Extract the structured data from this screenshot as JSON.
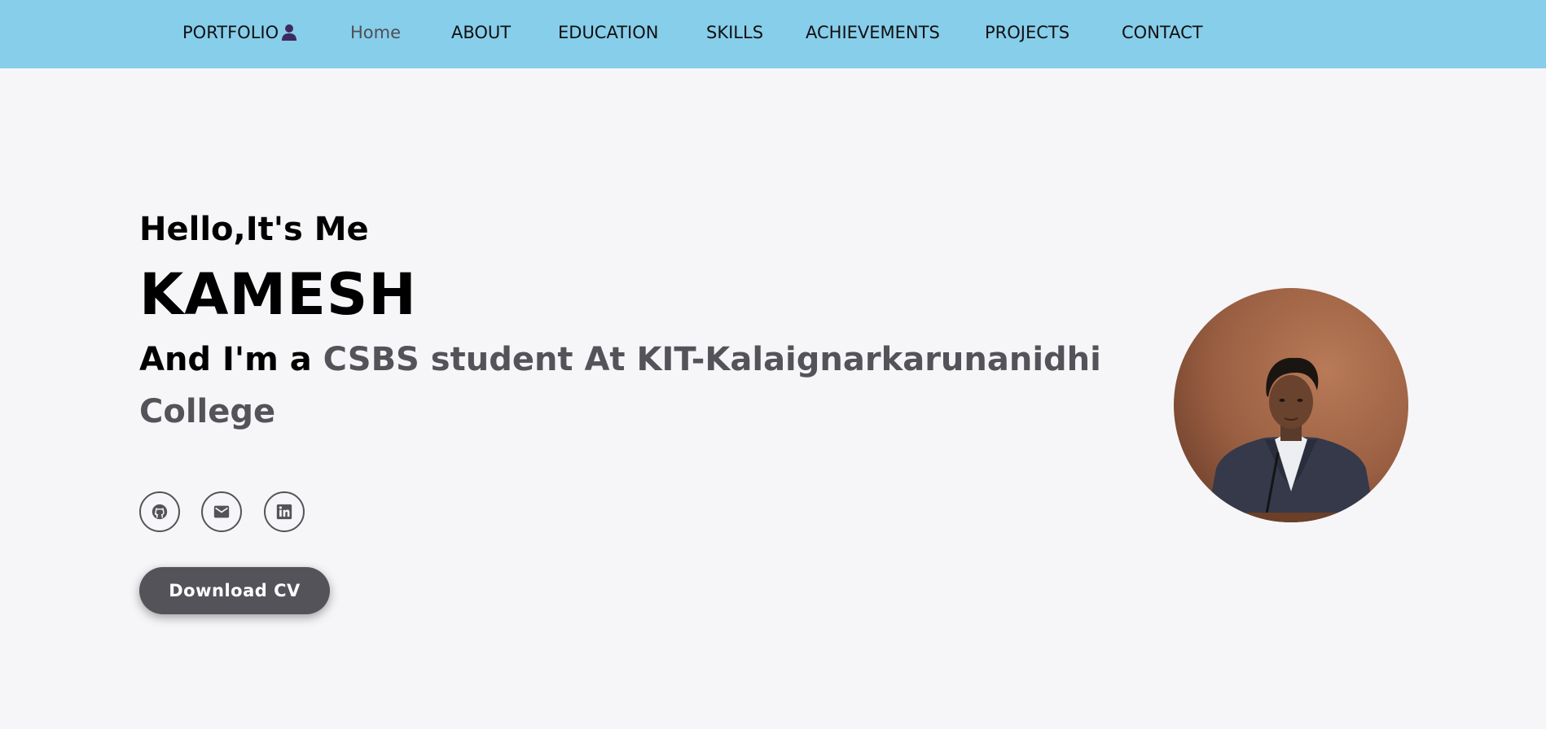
{
  "nav": {
    "brand_label": "PORTFOLIO",
    "brand_icon": "person-icon",
    "items": [
      {
        "label": "Home",
        "active": true
      },
      {
        "label": "ABOUT",
        "active": false
      },
      {
        "label": "EDUCATION",
        "active": false
      },
      {
        "label": "SKILLS",
        "active": false
      },
      {
        "label": "ACHIEVEMENTS",
        "active": false
      },
      {
        "label": "PROJECTS",
        "active": false
      },
      {
        "label": "CONTACT",
        "active": false
      }
    ]
  },
  "hero": {
    "greeting": "Hello,It's Me",
    "name": "KAMESH",
    "tagline_prefix": "And I'm a ",
    "tagline_highlight": "CSBS student At KIT-Kalaignarkarunanidhi College",
    "social": [
      {
        "icon": "github-icon"
      },
      {
        "icon": "mail-icon"
      },
      {
        "icon": "linkedin-icon"
      }
    ],
    "cv_button": "Download CV"
  },
  "colors": {
    "navbar_bg": "#87ceeb",
    "page_bg": "#f6f6f8",
    "accent": "#55535a",
    "active_nav": "#4e4e55"
  }
}
